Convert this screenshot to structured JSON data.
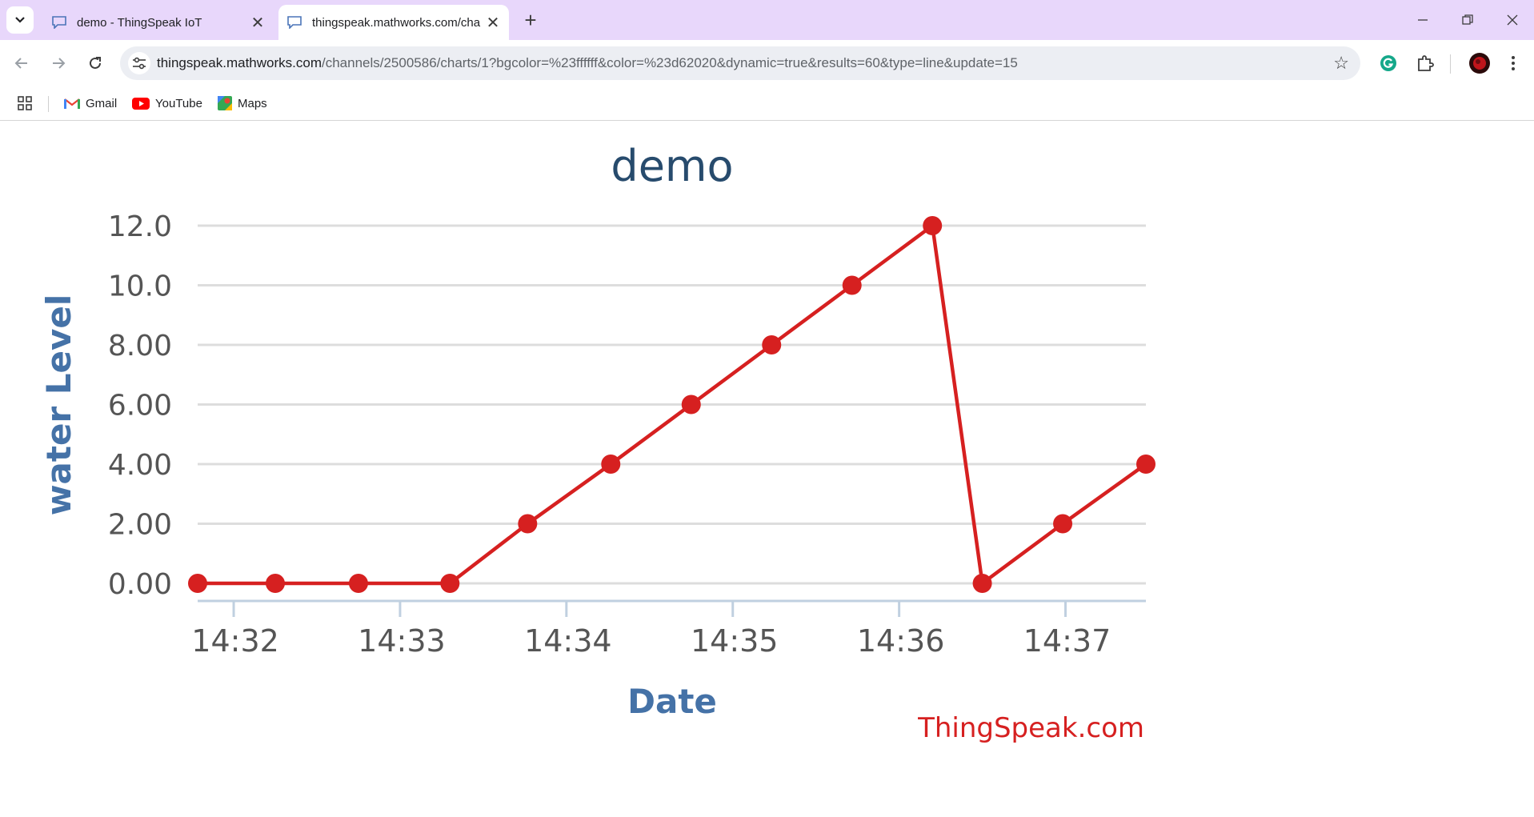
{
  "browser": {
    "tabs": [
      {
        "title": "demo - ThingSpeak IoT",
        "active": false
      },
      {
        "title": "thingspeak.mathworks.com/cha",
        "active": true
      }
    ],
    "url_host": "thingspeak.mathworks.com",
    "url_path": "/channels/2500586/charts/1?bgcolor=%23ffffff&color=%23d62020&dynamic=true&results=60&type=line&update=15",
    "bookmarks": [
      {
        "label": "Gmail",
        "icon": "gmail-icon"
      },
      {
        "label": "YouTube",
        "icon": "youtube-icon"
      },
      {
        "label": "Maps",
        "icon": "maps-icon"
      }
    ]
  },
  "chart_data": {
    "type": "line",
    "title": "demo",
    "xlabel": "Date",
    "ylabel": "water Level",
    "credit": "ThingSpeak.com",
    "color": "#d62020",
    "background": "#ffffff",
    "grid": true,
    "ylim": [
      0,
      12
    ],
    "xlim": [
      "14:31:47",
      "14:37:29"
    ],
    "yticks": [
      "0.00",
      "2.00",
      "4.00",
      "6.00",
      "8.00",
      "10.0",
      "12.0"
    ],
    "xticks": [
      "14:32",
      "14:33",
      "14:34",
      "14:35",
      "14:36",
      "14:37"
    ],
    "series": [
      {
        "x": [
          "14:31:47",
          "14:32:15",
          "14:32:45",
          "14:33:18",
          "14:33:46",
          "14:34:16",
          "14:34:45",
          "14:35:14",
          "14:35:43",
          "14:36:12",
          "14:36:30",
          "14:36:59",
          "14:37:29"
        ],
        "values": [
          0,
          0,
          0,
          0,
          2,
          4,
          6,
          8,
          10,
          12,
          0,
          2,
          4
        ]
      }
    ]
  }
}
